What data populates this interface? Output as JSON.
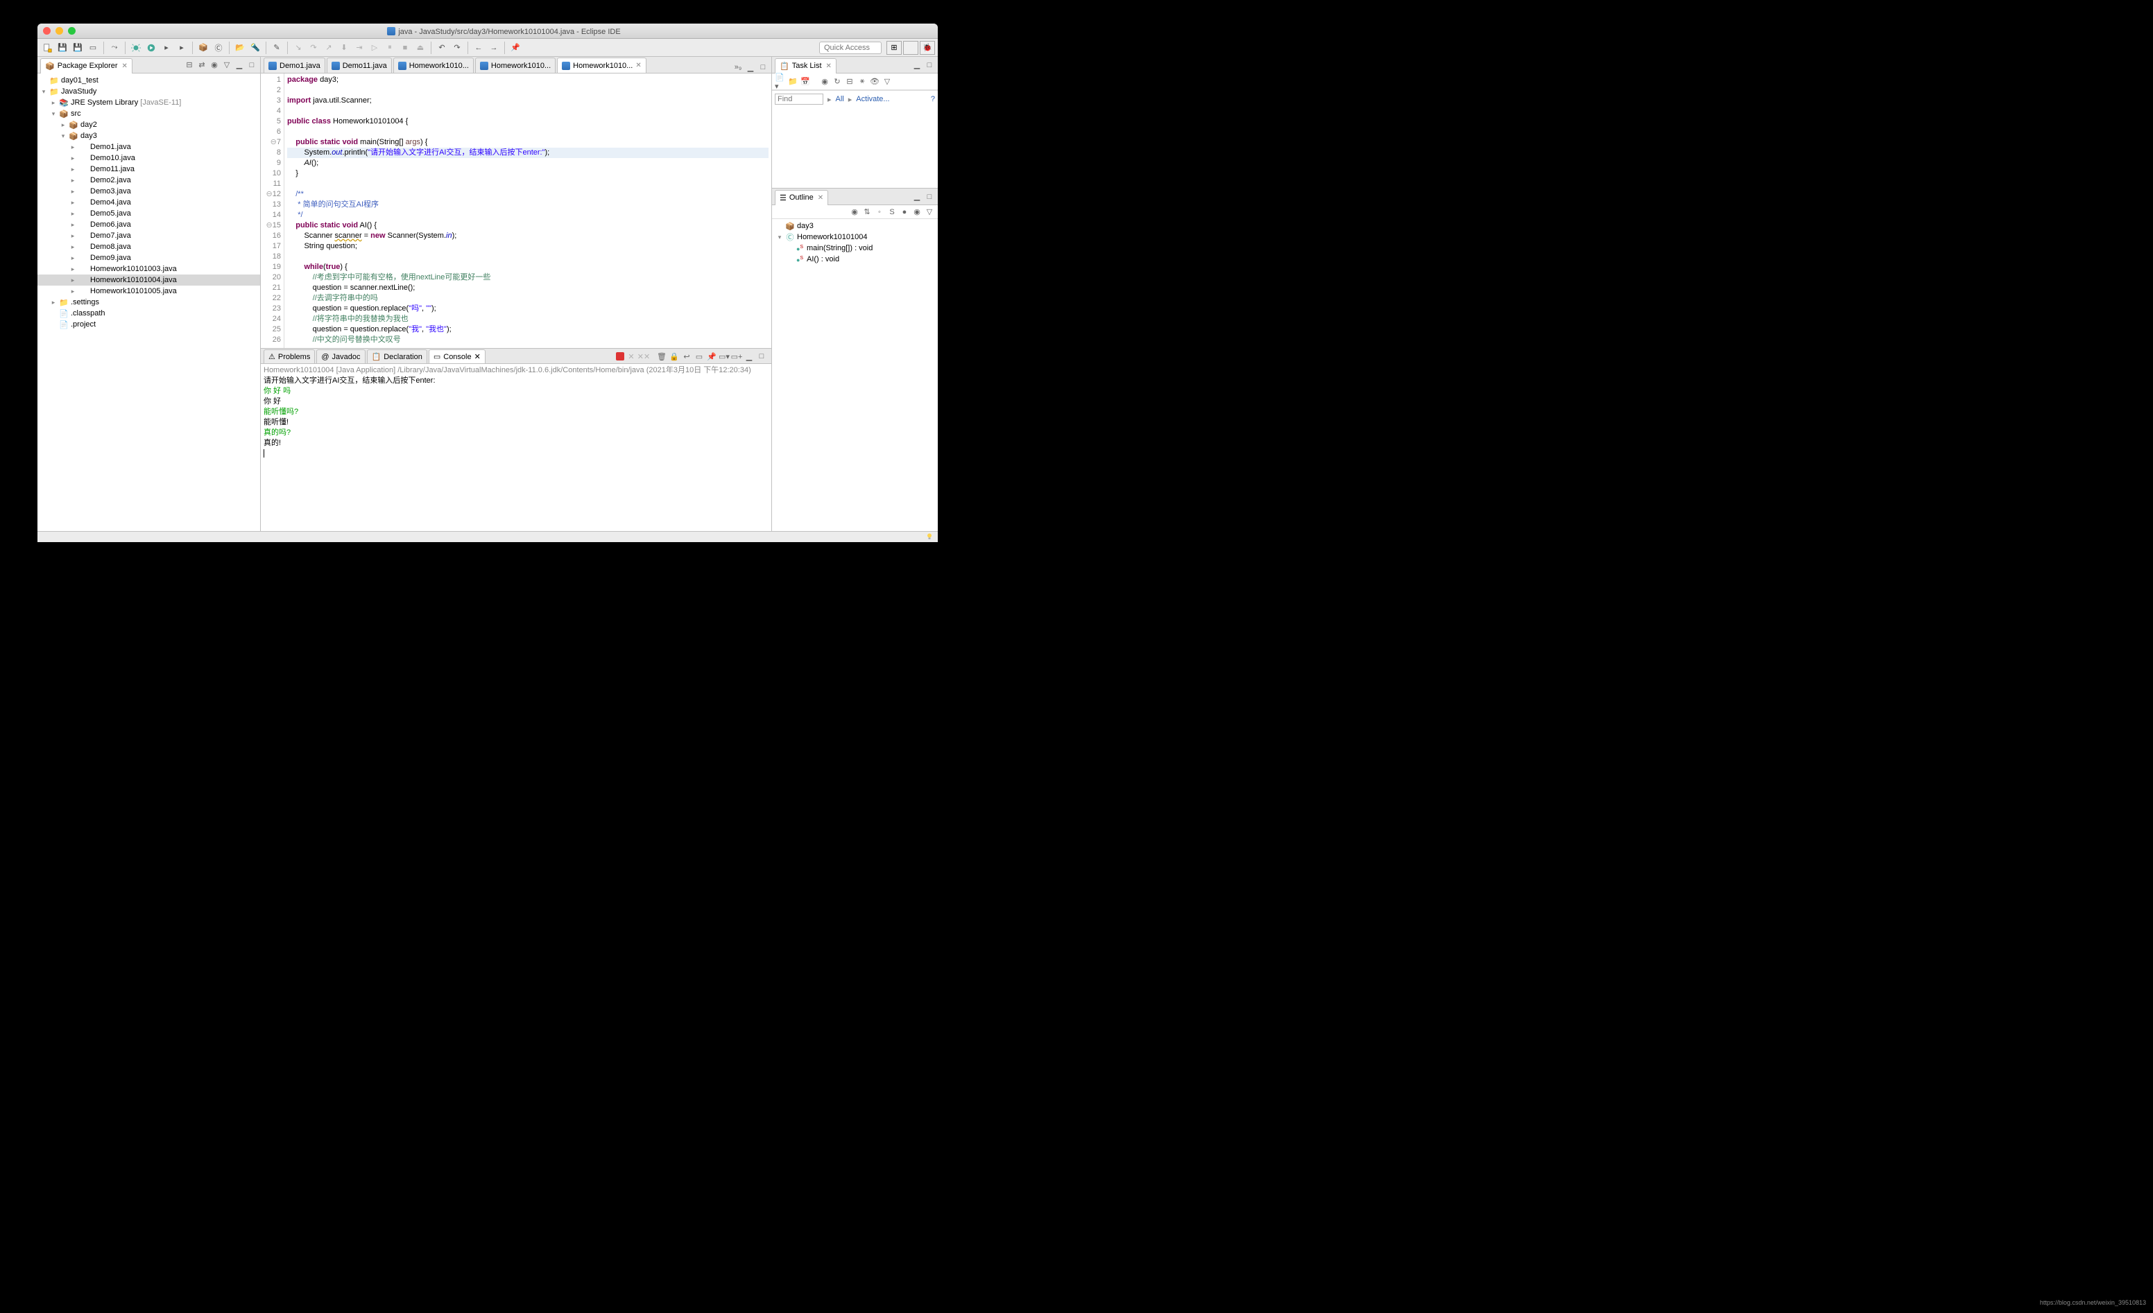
{
  "window": {
    "title": "java - JavaStudy/src/day3/Homework10101004.java - Eclipse IDE"
  },
  "quick_access_placeholder": "Quick Access",
  "package_explorer": {
    "title": "Package Explorer",
    "tree": {
      "day01_test": "day01_test",
      "java_study": "JavaStudy",
      "jre": "JRE System Library",
      "jre_suffix": " [JavaSE-11]",
      "src": "src",
      "day2": "day2",
      "day3": "day3",
      "files": [
        "Demo1.java",
        "Demo10.java",
        "Demo11.java",
        "Demo2.java",
        "Demo3.java",
        "Demo4.java",
        "Demo5.java",
        "Demo6.java",
        "Demo7.java",
        "Demo8.java",
        "Demo9.java",
        "Homework10101003.java",
        "Homework10101004.java",
        "Homework10101005.java"
      ],
      "settings": ".settings",
      "classpath": ".classpath",
      "project": ".project"
    }
  },
  "editor": {
    "tabs": [
      "Demo1.java",
      "Demo11.java",
      "Homework1010...",
      "Homework1010...",
      "Homework1010..."
    ],
    "active_tab": 4,
    "overflow": "»₉",
    "lines": [
      {
        "n": "1",
        "t": "<span class='kw'>package</span> day3;"
      },
      {
        "n": "2",
        "t": ""
      },
      {
        "n": "3",
        "t": "<span class='kw'>import</span> java.util.Scanner;"
      },
      {
        "n": "4",
        "t": ""
      },
      {
        "n": "5",
        "t": "<span class='kw'>public class</span> Homework10101004 {"
      },
      {
        "n": "6",
        "t": ""
      },
      {
        "n": "7",
        "t": "    <span class='kw'>public static void</span> main(String[] <span style='color:#6a3e3e'>args</span>) {",
        "fold": "⊖"
      },
      {
        "n": "8",
        "t": "        System.<span class='fld2'>out</span>.println(<span class='str'>\"请开始输入文字进行AI交互，结束输入后按下enter:\"</span>);",
        "hl": true
      },
      {
        "n": "9",
        "t": "        <span style='font-style:italic'>AI</span>();"
      },
      {
        "n": "10",
        "t": "    }"
      },
      {
        "n": "11",
        "t": ""
      },
      {
        "n": "12",
        "t": "    <span class='doc'>/**</span>",
        "fold": "⊖"
      },
      {
        "n": "13",
        "t": "<span class='doc'>     * 简单的问句交互AI程序</span>"
      },
      {
        "n": "14",
        "t": "<span class='doc'>     */</span>"
      },
      {
        "n": "15",
        "t": "    <span class='kw'>public static void</span> AI() {",
        "fold": "⊖"
      },
      {
        "n": "16",
        "t": "        Scanner <u style='text-decoration-style:wavy;text-decoration-color:#c90'>scanner</u> = <span class='kw'>new</span> Scanner(System.<span class='fld2'>in</span>);"
      },
      {
        "n": "17",
        "t": "        String question;"
      },
      {
        "n": "18",
        "t": ""
      },
      {
        "n": "19",
        "t": "        <span class='kw'>while</span>(<span class='kw'>true</span>) {"
      },
      {
        "n": "20",
        "t": "            <span class='cmt'>//考虑到字中可能有空格，使用nextLine可能更好一些</span>"
      },
      {
        "n": "21",
        "t": "            question = scanner.nextLine();"
      },
      {
        "n": "22",
        "t": "            <span class='cmt'>//去调字符串中的吗</span>"
      },
      {
        "n": "23",
        "t": "            question = question.replace(<span class='str'>\"吗\"</span>, <span class='str'>\"\"</span>);"
      },
      {
        "n": "24",
        "t": "            <span class='cmt'>//将字符串中的我替换为我也</span>"
      },
      {
        "n": "25",
        "t": "            question = question.replace(<span class='str'>\"我\"</span>, <span class='str'>\"我也\"</span>);"
      },
      {
        "n": "26",
        "t": "            <span class='cmt'>//中文的问号替换中文叹号</span>"
      }
    ]
  },
  "task_list": {
    "title": "Task List",
    "find_placeholder": "Find",
    "all": "All",
    "activate": "Activate..."
  },
  "outline": {
    "title": "Outline",
    "pkg": "day3",
    "class": "Homework10101004",
    "methods": [
      {
        "name": "main(String[]) : void",
        "static": true
      },
      {
        "name": "AI() : void",
        "static": true
      }
    ]
  },
  "bottom_tabs": {
    "problems": "Problems",
    "javadoc": "Javadoc",
    "declaration": "Declaration",
    "console": "Console"
  },
  "console": {
    "header": "Homework10101004 [Java Application] /Library/Java/JavaVirtualMachines/jdk-11.0.6.jdk/Contents/Home/bin/java (2021年3月10日 下午12:20:34)",
    "lines": [
      {
        "cls": "out",
        "t": "请开始输入文字进行AI交互，结束输入后按下enter:"
      },
      {
        "cls": "in",
        "t": "你 好 吗"
      },
      {
        "cls": "out",
        "t": "你 好"
      },
      {
        "cls": "in",
        "t": "能听懂吗?"
      },
      {
        "cls": "out",
        "t": "能听懂!"
      },
      {
        "cls": "in",
        "t": "真的吗?"
      },
      {
        "cls": "out",
        "t": "真的!"
      }
    ]
  },
  "watermark": "https://blog.csdn.net/weixin_39510813"
}
